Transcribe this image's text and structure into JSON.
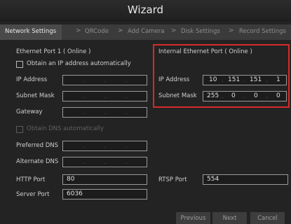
{
  "window": {
    "title": "Wizard"
  },
  "steps": {
    "items": [
      {
        "label": "Network Settings"
      },
      {
        "label": "QRCode"
      },
      {
        "label": "Add Camera"
      },
      {
        "label": "Disk Settings"
      },
      {
        "label": "Record Settings"
      }
    ],
    "separator": ">"
  },
  "port1": {
    "title": "Ethernet Port 1 ( Online )",
    "obtain_ip_label": "Obtain an IP address automatically",
    "obtain_ip_checked": false,
    "ip_label": "IP Address",
    "subnet_label": "Subnet Mask",
    "gateway_label": "Gateway",
    "obtain_dns_label": "Obtain DNS automatically",
    "preferred_dns_label": "Preferred DNS",
    "alternate_dns_label": "Alternate DNS",
    "ip_dot": "."
  },
  "internal": {
    "title": "Internal Ethernet Port ( Online )",
    "ip_label": "IP Address",
    "ip": [
      "10",
      "151",
      "151",
      "1"
    ],
    "subnet_label": "Subnet Mask",
    "subnet": [
      "255",
      "0",
      "0",
      "0"
    ]
  },
  "ports": {
    "http_label": "HTTP Port",
    "http_value": "80",
    "rtsp_label": "RTSP Port",
    "rtsp_value": "554",
    "server_label": "Server Port",
    "server_value": "6036"
  },
  "buttons": {
    "previous": "Previous",
    "next": "Next",
    "cancel": "Cancel"
  },
  "colors": {
    "highlight_border": "#d82a2a",
    "background": "#232323"
  }
}
